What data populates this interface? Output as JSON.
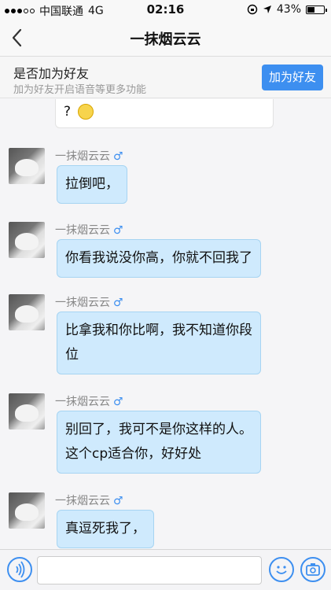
{
  "status_bar": {
    "carrier": "中国联通",
    "network": "4G",
    "time": "02:16",
    "battery": "43%",
    "battery_level": 0.43
  },
  "nav": {
    "title": "一抹烟云云"
  },
  "friend_prompt": {
    "title": "是否加为好友",
    "subtitle": "加为好友开启语音等更多功能",
    "button_label": "加为好友"
  },
  "partial_message": {
    "text": "?"
  },
  "messages": [
    {
      "sender": "一抹烟云云",
      "gender_symbol": "♂",
      "lines": [
        "拉倒吧，"
      ]
    },
    {
      "sender": "一抹烟云云",
      "gender_symbol": "♂",
      "lines": [
        "你看我说没你高，你就不回我了"
      ]
    },
    {
      "sender": "一抹烟云云",
      "gender_symbol": "♂",
      "lines": [
        "比拿我和你比啊，我不知道你段",
        "位"
      ]
    },
    {
      "sender": "一抹烟云云",
      "gender_symbol": "♂",
      "lines": [
        "别回了，我可不是你这样的人。",
        "这个cp适合你，好好处"
      ]
    },
    {
      "sender": "一抹烟云云",
      "gender_symbol": "♂",
      "lines": [
        "真逗死我了，"
      ]
    }
  ],
  "colors": {
    "accent": "#3d8ff0",
    "bubble": "#cfeafd",
    "bubble_border": "#a6d4f2"
  }
}
